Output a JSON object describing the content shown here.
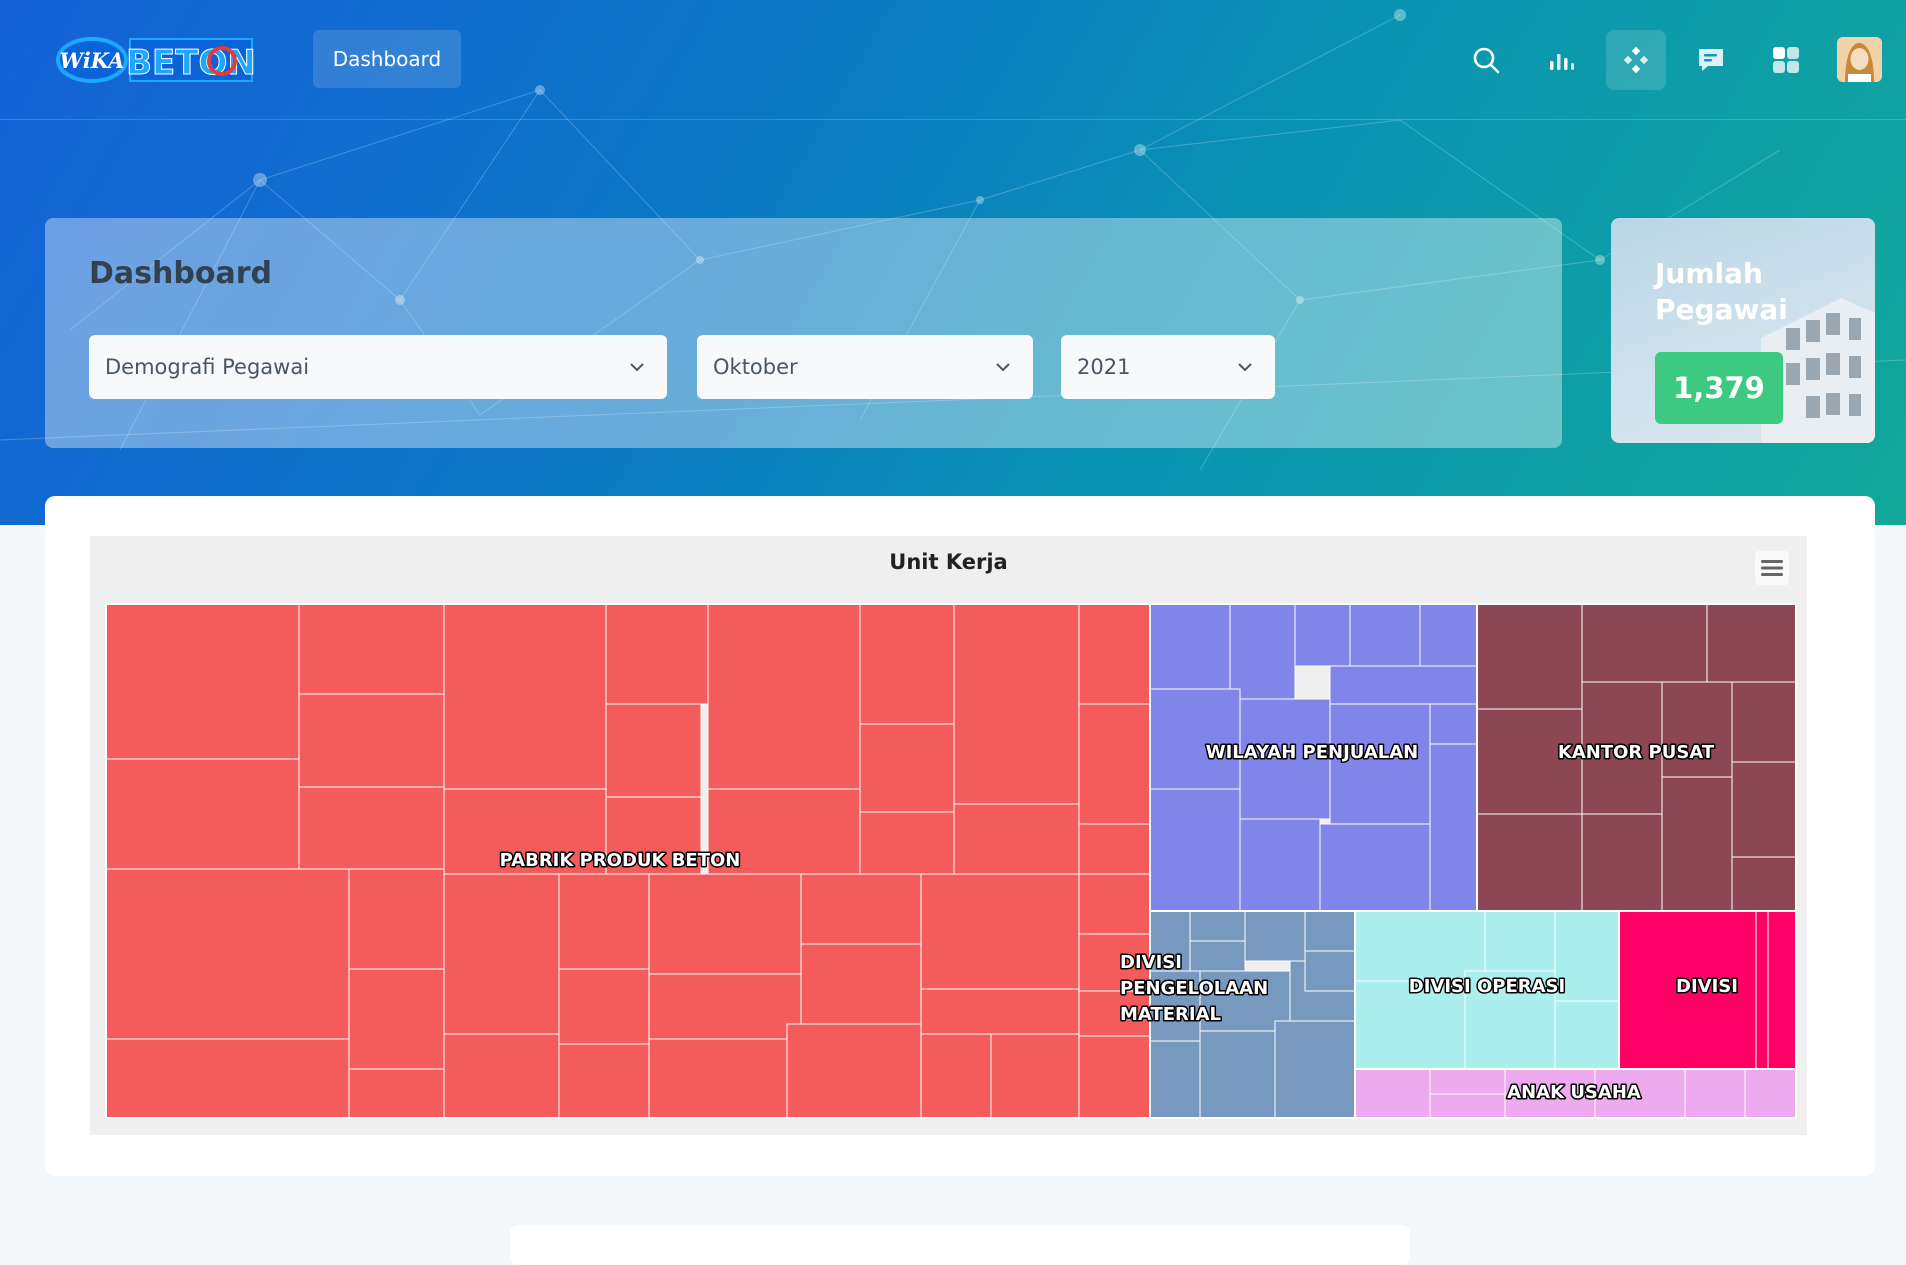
{
  "brand": {
    "logo_left": "WiKA",
    "logo_right": "BETON"
  },
  "nav": {
    "dashboard_label": "Dashboard"
  },
  "toolbar": {
    "icons": [
      "search-icon",
      "bar-chart-icon",
      "diamond-grid-icon",
      "chat-icon",
      "dashboard-grid-icon"
    ],
    "active_icon": "diamond-grid-icon"
  },
  "filters": {
    "title": "Dashboard",
    "report": "Demografi Pegawai",
    "month": "Oktober",
    "year": "2021"
  },
  "stat": {
    "title": "Jumlah Pegawai",
    "value": "1,379"
  },
  "chart_data": {
    "type": "treemap",
    "title": "Unit Kerja",
    "groups": [
      {
        "name": "PABRIK PRODUK BETON",
        "color": "#f45b5b"
      },
      {
        "name": "WILAYAH PENJUALAN",
        "color": "#8085e9"
      },
      {
        "name": "KANTOR PUSAT",
        "color": "#8d4654"
      },
      {
        "name": "DIVISI PENGELOLAAN MATERIAL",
        "color": "#7798bf"
      },
      {
        "name": "DIVISI OPERASI",
        "color": "#aaeeee"
      },
      {
        "name": "DIVISI",
        "color": "#ff0066"
      },
      {
        "name": "ANAK USAHA",
        "color": "#eeaaee"
      }
    ]
  },
  "colors": {
    "accent_green": "#3dc97f",
    "hero_start": "#1561d8",
    "hero_end": "#12a89a"
  }
}
